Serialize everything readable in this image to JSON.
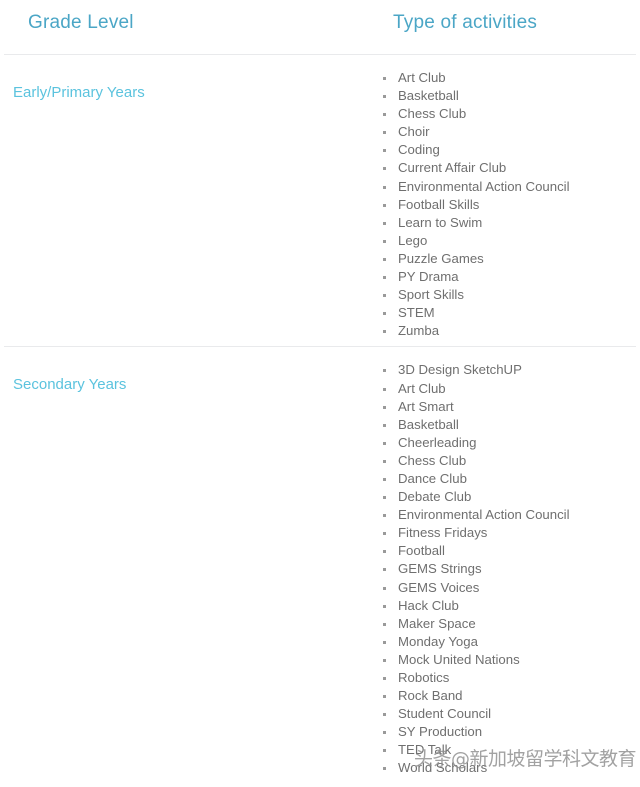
{
  "table": {
    "headers": {
      "grade_level": "Grade Level",
      "type_of_activities": "Type of activities"
    },
    "rows": [
      {
        "grade": "Early/Primary Years",
        "activities": [
          "Art Club",
          "Basketball",
          "Chess Club",
          "Choir",
          "Coding",
          "Current Affair Club",
          "Environmental Action Council",
          "Football Skills",
          "Learn to Swim",
          "Lego",
          "Puzzle Games",
          "PY Drama",
          "Sport Skills",
          "STEM",
          "Zumba"
        ]
      },
      {
        "grade": "Secondary Years",
        "activities": [
          "3D Design SketchUP",
          "Art Club",
          "Art Smart",
          "Basketball",
          "Cheerleading",
          "Chess Club",
          "Dance Club",
          "Debate Club",
          "Environmental Action Council",
          "Fitness Fridays",
          "Football",
          "GEMS Strings",
          "GEMS Voices",
          "Hack Club",
          "Maker Space",
          "Monday Yoga",
          "Mock United Nations",
          "Robotics",
          "Rock Band",
          "Student Council",
          "SY Production",
          "TED Talk",
          "World Scholars"
        ]
      }
    ]
  },
  "watermark": {
    "text": "头条@新加坡留学科文教育"
  },
  "colors": {
    "header_text": "#4ba6c6",
    "grade_label_text": "#5bc3de",
    "activity_text": "#6f6f6f",
    "bullet": "#9a9a9a",
    "divider": "#e9eaec",
    "background": "#ffffff"
  }
}
